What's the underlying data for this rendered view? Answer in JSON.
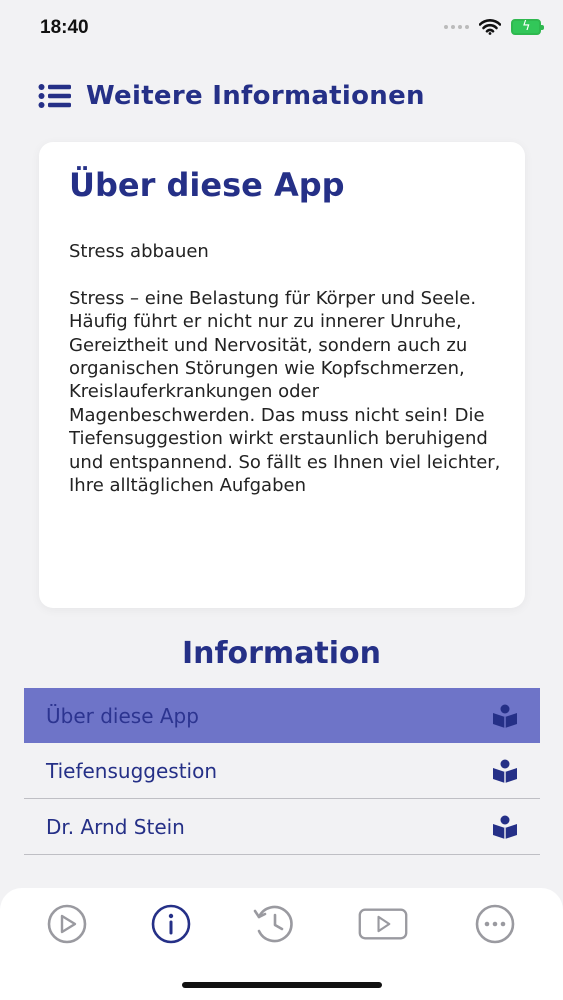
{
  "status_bar": {
    "time": "18:40"
  },
  "header": {
    "title": "Weitere Informationen",
    "menu_icon": "list-icon"
  },
  "card": {
    "title": "Über diese App",
    "paragraphs": [
      "Stress abbauen",
      "Stress – eine Belastung für Körper und Seele. Häufig führt er nicht nur zu innerer Unruhe, Gereiztheit und Nervosität, sondern auch zu organischen Störungen wie Kopfschmerzen, Kreislauferkrankungen oder Magenbeschwerden. Das muss nicht sein! Die Tiefensuggestion wirkt erstaunlich beruhigend und entspannend. So fällt es Ihnen viel leichter, Ihre alltäglichen Aufgaben"
    ]
  },
  "info": {
    "title": "Information",
    "items": [
      {
        "label": "Über diese App",
        "icon": "book-icon",
        "active": true
      },
      {
        "label": "Tiefensuggestion",
        "icon": "book-icon",
        "active": false
      },
      {
        "label": "Dr. Arnd Stein",
        "icon": "book-icon",
        "active": false
      }
    ]
  },
  "tabbar": {
    "tabs": [
      {
        "icon": "play-circle-icon",
        "active": false
      },
      {
        "icon": "info-icon",
        "active": true
      },
      {
        "icon": "history-icon",
        "active": false
      },
      {
        "icon": "video-icon",
        "active": false
      },
      {
        "icon": "more-icon",
        "active": false
      }
    ]
  },
  "colors": {
    "accent": "#253087",
    "selected_row": "#6e74c8",
    "inactive_icon": "#9a9aa0",
    "battery": "#32c759"
  }
}
